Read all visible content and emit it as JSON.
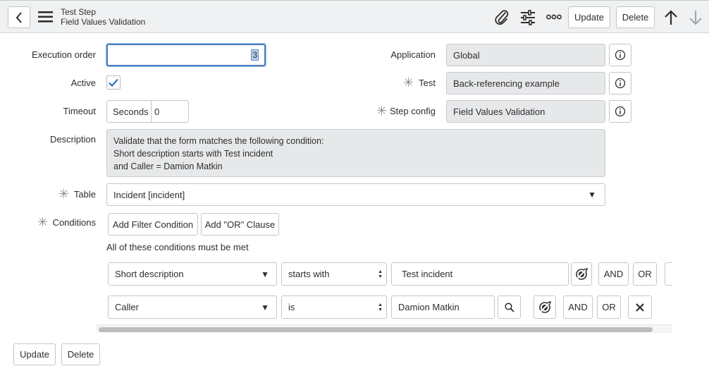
{
  "header": {
    "title": "Test Step",
    "subtitle": "Field Values Validation",
    "update_label": "Update",
    "delete_label": "Delete"
  },
  "form": {
    "execution_order": {
      "label": "Execution order",
      "value": "3"
    },
    "active": {
      "label": "Active",
      "checked": true
    },
    "timeout": {
      "label": "Timeout",
      "unit": "Seconds",
      "value": "0"
    },
    "description": {
      "label": "Description",
      "lines": [
        "Validate that the form matches the following condition:",
        "Short description starts with Test incident",
        "and Caller = Damion Matkin"
      ]
    },
    "application": {
      "label": "Application",
      "value": "Global"
    },
    "test": {
      "label": "Test",
      "value": "Back-referencing example"
    },
    "step_config": {
      "label": "Step config",
      "value": "Field Values Validation"
    },
    "table": {
      "label": "Table",
      "value": "Incident [incident]"
    },
    "conditions": {
      "label": "Conditions",
      "add_filter_label": "Add Filter Condition",
      "add_or_label": "Add \"OR\" Clause",
      "summary": "All of these conditions must be met",
      "rows": [
        {
          "field": "Short description",
          "operator": "starts with",
          "value": "Test incident",
          "and": "AND",
          "or": "OR"
        },
        {
          "field": "Caller",
          "operator": "is",
          "value": "Damion Matkin",
          "and": "AND",
          "or": "OR"
        }
      ]
    }
  },
  "footer": {
    "update_label": "Update",
    "delete_label": "Delete"
  },
  "colors": {
    "header_bg": "#f0f1f2",
    "focus_border": "#4a7fc1",
    "check": "#2f6fc0",
    "readonly_bg": "#e6e8ea"
  }
}
